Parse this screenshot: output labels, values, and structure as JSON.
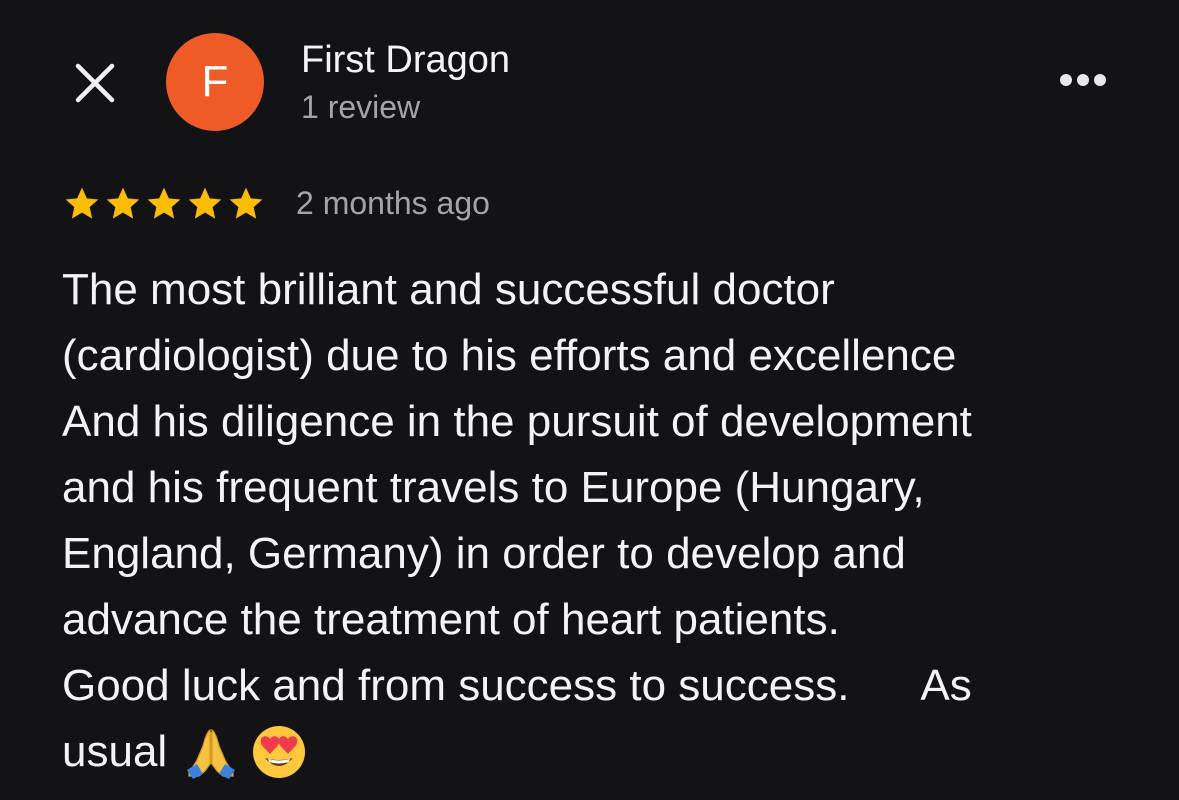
{
  "header": {
    "close_icon": "close-icon",
    "avatar_letter": "F",
    "avatar_color": "#ee5b26",
    "author_name": "First Dragon",
    "review_count": "1 review",
    "more_icon": "more-horizontal-icon"
  },
  "review": {
    "rating": 5,
    "rating_max": 5,
    "star_color": "#fbbc04",
    "date": "2 months ago",
    "lines": [
      "The most brilliant and successful doctor",
      "(cardiologist) due to his efforts and excellence",
      "And his diligence in the pursuit of development",
      "and his frequent travels to Europe (Hungary,",
      "England, Germany) in order to develop and",
      "advance the treatment of heart patients.",
      "Good luck and from success to success.      As",
      "usual"
    ],
    "emojis": [
      "folded-hands-emoji",
      "heart-eyes-emoji"
    ]
  }
}
